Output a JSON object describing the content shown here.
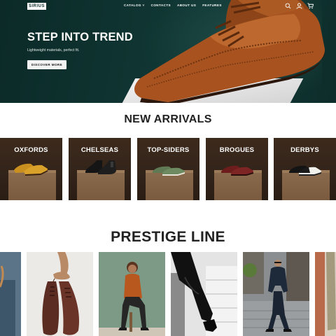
{
  "header": {
    "logo": "SIRIUS",
    "nav": [
      "CATALOG",
      "CONTACTS",
      "ABOUT US",
      "FEATURES"
    ],
    "catalog_caret": "˅",
    "icons": [
      "search-icon",
      "user-icon",
      "cart-icon"
    ]
  },
  "hero": {
    "title": "STEP INTO TREND",
    "subtitle": "Lightweight materials, perfect fit.",
    "button": "DISCOVER MORE"
  },
  "new_arrivals": {
    "title": "NEW ARRIVALS",
    "categories": [
      "OXFORDS",
      "CHELSEAS",
      "TOP-SIDERS",
      "BROGUES",
      "DERBYS"
    ]
  },
  "prestige": {
    "title": "PRESTIGE LINE"
  },
  "colors": {
    "hero_bg": "#0f3431",
    "card_bg": "#3a281b",
    "shoe_brown": "#a8531f"
  }
}
